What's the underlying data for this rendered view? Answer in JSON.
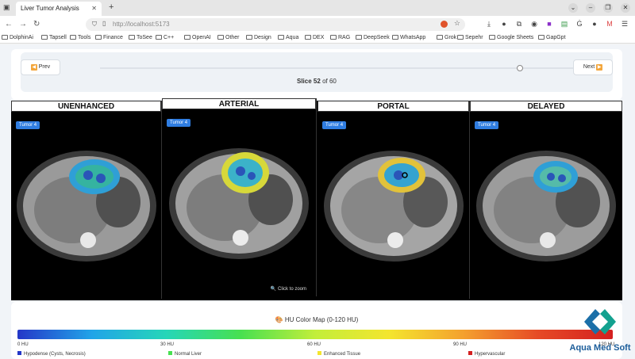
{
  "browser": {
    "tab_title": "Liver Tumor Analysis",
    "url": "http://localhost:5173",
    "bookmarks": [
      "DolphinAi",
      "Tapsell",
      "Tools",
      "Finance",
      "ToSee",
      "C++",
      "OpenAI",
      "Other",
      "Design",
      "Aqua",
      "DEX",
      "RAG",
      "DeepSeek",
      "WhatsApp",
      "Grok",
      "Sepehr",
      "Google Sheets",
      "GapGpt"
    ]
  },
  "controls": {
    "prev_label": "Prev",
    "next_label": "Next",
    "slice_word": "Slice",
    "slice_current": "52",
    "slice_of": "of 60",
    "slider_fraction": 0.86
  },
  "phases": [
    {
      "title": "UNENHANCED",
      "badge": "Tumor 4"
    },
    {
      "title": "ARTERIAL",
      "badge": "Tumor 4",
      "hint": "Click to zoom"
    },
    {
      "title": "PORTAL",
      "badge": "Tumor 4"
    },
    {
      "title": "DELAYED",
      "badge": "Tumor 4"
    }
  ],
  "hu_map": {
    "title": "HU Color Map (0-120 HU)",
    "ticks": [
      "0 HU",
      "30 HU",
      "60 HU",
      "90 HU",
      "120 HU"
    ],
    "legend": [
      {
        "label": "Hypodense (Cysts, Necrosis)",
        "color": "#2437c8"
      },
      {
        "label": "Normal Liver",
        "color": "#48e050"
      },
      {
        "label": "Enhanced Tissue",
        "color": "#f4e52e"
      },
      {
        "label": "Hypervascular",
        "color": "#d42020"
      }
    ]
  },
  "watermark": {
    "text": "Aqua Med Soft"
  }
}
